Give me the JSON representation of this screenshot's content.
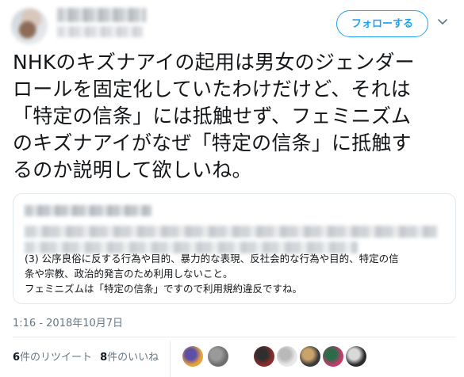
{
  "header": {
    "follow_label": "フォローする"
  },
  "tweet": {
    "text": "NHKのキズナアイの起用は男女のジェンダー\nロールを固定化していたわけだけど、それは\n「特定の信条」には抵触せず、フェミニズム\nのキズナアイがなぜ「特定の信条」に抵触す\nるのか説明して欲しいね。",
    "timestamp": "1:16 - 2018年10月7日"
  },
  "quote": {
    "body": "(3) 公序良俗に反する行為や目的、暴力的な表現、反社会的な行為や目的、特定の信\n条や宗教、政治的発言のため利用しないこと。\nフェミニズムは「特定の信条」ですので利用規約違反ですね。"
  },
  "stats": {
    "retweet_count": "6",
    "retweet_label": "件のリツイート",
    "like_count": "8",
    "like_label": "件のいいね"
  },
  "likers": [
    {
      "name": "liker-1",
      "colors": [
        "#e9a23b",
        "#5d4ea8"
      ]
    },
    {
      "name": "liker-2",
      "colors": [
        "#6e6e6e",
        "#9a9a9a"
      ]
    },
    {
      "name": "liker-3",
      "colors": [
        "#8a2c2c",
        "#2f2f2f"
      ]
    },
    {
      "name": "liker-4",
      "colors": [
        "#e8e8e8",
        "#b9b9b9"
      ]
    },
    {
      "name": "liker-5",
      "colors": [
        "#3b3b3b",
        "#c9a36a"
      ]
    },
    {
      "name": "liker-6",
      "colors": [
        "#c23c6a",
        "#2b6b4a"
      ]
    },
    {
      "name": "liker-7",
      "colors": [
        "#2a2a2a",
        "#d9d9d9"
      ]
    }
  ]
}
